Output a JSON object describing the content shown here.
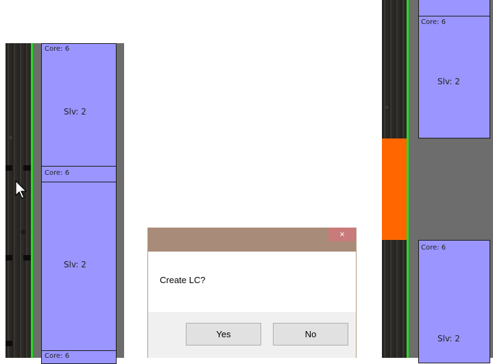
{
  "left_panel": {
    "blocks": [
      {
        "core": "Core: 6",
        "slv": "Slv: 2"
      },
      {
        "core": "Core: 6",
        "slv": "Slv: 2"
      },
      {
        "core": "Core: 6"
      }
    ]
  },
  "right_panel": {
    "blocks": [
      {
        "core": "Core: 6",
        "slv": "Slv: 2"
      },
      {
        "core": "Core: 6",
        "slv": "Slv: 2"
      }
    ],
    "highlight_color": "#ff6600"
  },
  "dialog": {
    "close_glyph": "×",
    "message": "Create LC?",
    "yes_label": "Yes",
    "no_label": "No"
  },
  "colors": {
    "block_fill": "#9a95ff",
    "track_green": "#1fe01f",
    "gray_strip": "#6d6d6d"
  }
}
